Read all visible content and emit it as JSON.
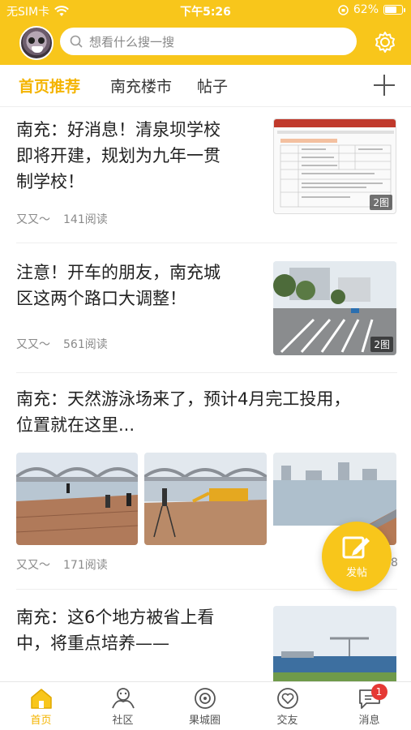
{
  "status": {
    "carrier": "无SIM卡",
    "time": "下午5:26",
    "battery": "62%",
    "battery_level": 0.62
  },
  "search": {
    "placeholder": "想看什么搜一搜"
  },
  "tabs": [
    {
      "label": "首页推荐",
      "active": true
    },
    {
      "label": "南充楼市",
      "active": false
    },
    {
      "label": "帖子",
      "active": false
    }
  ],
  "articles": [
    {
      "title_lines": [
        "南充：好消息！清泉坝学校",
        "即将开建，规划为九年一贯",
        "制学校！"
      ],
      "author": "又又～",
      "reads": "141阅读",
      "image_count": "2图"
    },
    {
      "title_lines": [
        "注意！开车的朋友，南充城",
        "区这两个路口大调整！"
      ],
      "author": "又又～",
      "reads": "561阅读",
      "image_count": "2图"
    },
    {
      "title_lines": [
        "南充：天然游泳场来了，预计4月完工投用，",
        "位置就在这里..."
      ],
      "author": "又又～",
      "reads": "171阅读",
      "image_count": "8"
    },
    {
      "title_lines": [
        "南充：这6个地方被省上看",
        "中，将重点培养——"
      ]
    }
  ],
  "fab": {
    "label": "发帖"
  },
  "nav": [
    {
      "label": "首页",
      "icon": "home-icon",
      "active": true
    },
    {
      "label": "社区",
      "icon": "community-icon",
      "active": false
    },
    {
      "label": "果城圈",
      "icon": "circle-icon",
      "active": false
    },
    {
      "label": "交友",
      "icon": "heart-icon",
      "active": false
    },
    {
      "label": "消息",
      "icon": "message-icon",
      "active": false,
      "badge": "1"
    }
  ],
  "colors": {
    "accent": "#f8c61b",
    "active_text": "#f4b400",
    "badge": "#e53935"
  }
}
